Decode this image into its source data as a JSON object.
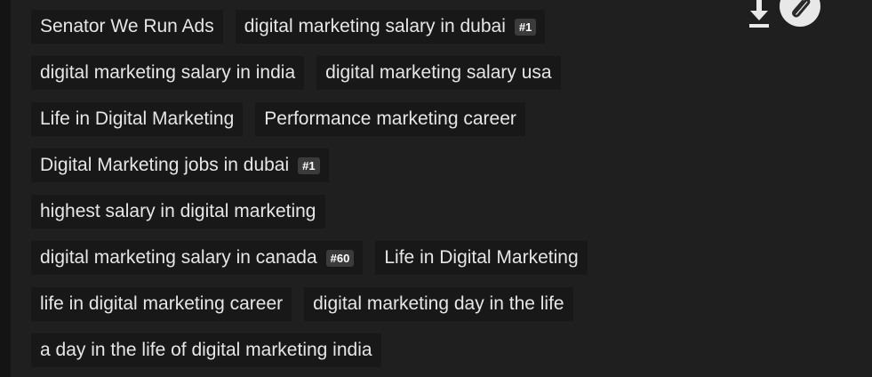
{
  "tags": [
    {
      "label": "Senator We Run Ads",
      "rank": ""
    },
    {
      "label": "digital marketing salary in dubai",
      "rank": "#1"
    },
    {
      "label": "digital marketing salary in india",
      "rank": ""
    },
    {
      "label": "digital marketing salary usa",
      "rank": ""
    },
    {
      "label": "Life in Digital Marketing",
      "rank": ""
    },
    {
      "label": "Performance marketing career",
      "rank": ""
    },
    {
      "label": "Digital Marketing jobs in dubai",
      "rank": "#1"
    },
    {
      "label": "highest salary in digital marketing",
      "rank": ""
    },
    {
      "label": "digital marketing salary in canada",
      "rank": "#60"
    },
    {
      "label": "Life in Digital Marketing",
      "rank": ""
    },
    {
      "label": "life in digital marketing career",
      "rank": ""
    },
    {
      "label": "digital marketing day in the life",
      "rank": ""
    },
    {
      "label": "a day in the life of digital marketing india",
      "rank": ""
    }
  ],
  "toolbar": {
    "download_icon": "download-icon",
    "clip_icon": "paperclip-icon"
  },
  "colors": {
    "background": "#1f1f1f",
    "tag_background": "#181818",
    "tag_text": "#e6e6e6",
    "rank_badge": "#3b3b3b"
  }
}
